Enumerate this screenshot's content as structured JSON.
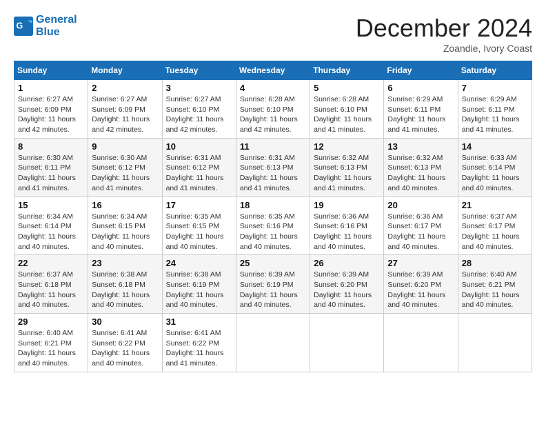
{
  "header": {
    "logo_line1": "General",
    "logo_line2": "Blue",
    "month_title": "December 2024",
    "location": "Zoandie, Ivory Coast"
  },
  "weekdays": [
    "Sunday",
    "Monday",
    "Tuesday",
    "Wednesday",
    "Thursday",
    "Friday",
    "Saturday"
  ],
  "weeks": [
    [
      {
        "day": "1",
        "sunrise": "6:27 AM",
        "sunset": "6:09 PM",
        "daylight": "11 hours and 42 minutes."
      },
      {
        "day": "2",
        "sunrise": "6:27 AM",
        "sunset": "6:09 PM",
        "daylight": "11 hours and 42 minutes."
      },
      {
        "day": "3",
        "sunrise": "6:27 AM",
        "sunset": "6:10 PM",
        "daylight": "11 hours and 42 minutes."
      },
      {
        "day": "4",
        "sunrise": "6:28 AM",
        "sunset": "6:10 PM",
        "daylight": "11 hours and 42 minutes."
      },
      {
        "day": "5",
        "sunrise": "6:28 AM",
        "sunset": "6:10 PM",
        "daylight": "11 hours and 41 minutes."
      },
      {
        "day": "6",
        "sunrise": "6:29 AM",
        "sunset": "6:11 PM",
        "daylight": "11 hours and 41 minutes."
      },
      {
        "day": "7",
        "sunrise": "6:29 AM",
        "sunset": "6:11 PM",
        "daylight": "11 hours and 41 minutes."
      }
    ],
    [
      {
        "day": "8",
        "sunrise": "6:30 AM",
        "sunset": "6:11 PM",
        "daylight": "11 hours and 41 minutes."
      },
      {
        "day": "9",
        "sunrise": "6:30 AM",
        "sunset": "6:12 PM",
        "daylight": "11 hours and 41 minutes."
      },
      {
        "day": "10",
        "sunrise": "6:31 AM",
        "sunset": "6:12 PM",
        "daylight": "11 hours and 41 minutes."
      },
      {
        "day": "11",
        "sunrise": "6:31 AM",
        "sunset": "6:13 PM",
        "daylight": "11 hours and 41 minutes."
      },
      {
        "day": "12",
        "sunrise": "6:32 AM",
        "sunset": "6:13 PM",
        "daylight": "11 hours and 41 minutes."
      },
      {
        "day": "13",
        "sunrise": "6:32 AM",
        "sunset": "6:13 PM",
        "daylight": "11 hours and 40 minutes."
      },
      {
        "day": "14",
        "sunrise": "6:33 AM",
        "sunset": "6:14 PM",
        "daylight": "11 hours and 40 minutes."
      }
    ],
    [
      {
        "day": "15",
        "sunrise": "6:34 AM",
        "sunset": "6:14 PM",
        "daylight": "11 hours and 40 minutes."
      },
      {
        "day": "16",
        "sunrise": "6:34 AM",
        "sunset": "6:15 PM",
        "daylight": "11 hours and 40 minutes."
      },
      {
        "day": "17",
        "sunrise": "6:35 AM",
        "sunset": "6:15 PM",
        "daylight": "11 hours and 40 minutes."
      },
      {
        "day": "18",
        "sunrise": "6:35 AM",
        "sunset": "6:16 PM",
        "daylight": "11 hours and 40 minutes."
      },
      {
        "day": "19",
        "sunrise": "6:36 AM",
        "sunset": "6:16 PM",
        "daylight": "11 hours and 40 minutes."
      },
      {
        "day": "20",
        "sunrise": "6:36 AM",
        "sunset": "6:17 PM",
        "daylight": "11 hours and 40 minutes."
      },
      {
        "day": "21",
        "sunrise": "6:37 AM",
        "sunset": "6:17 PM",
        "daylight": "11 hours and 40 minutes."
      }
    ],
    [
      {
        "day": "22",
        "sunrise": "6:37 AM",
        "sunset": "6:18 PM",
        "daylight": "11 hours and 40 minutes."
      },
      {
        "day": "23",
        "sunrise": "6:38 AM",
        "sunset": "6:18 PM",
        "daylight": "11 hours and 40 minutes."
      },
      {
        "day": "24",
        "sunrise": "6:38 AM",
        "sunset": "6:19 PM",
        "daylight": "11 hours and 40 minutes."
      },
      {
        "day": "25",
        "sunrise": "6:39 AM",
        "sunset": "6:19 PM",
        "daylight": "11 hours and 40 minutes."
      },
      {
        "day": "26",
        "sunrise": "6:39 AM",
        "sunset": "6:20 PM",
        "daylight": "11 hours and 40 minutes."
      },
      {
        "day": "27",
        "sunrise": "6:39 AM",
        "sunset": "6:20 PM",
        "daylight": "11 hours and 40 minutes."
      },
      {
        "day": "28",
        "sunrise": "6:40 AM",
        "sunset": "6:21 PM",
        "daylight": "11 hours and 40 minutes."
      }
    ],
    [
      {
        "day": "29",
        "sunrise": "6:40 AM",
        "sunset": "6:21 PM",
        "daylight": "11 hours and 40 minutes."
      },
      {
        "day": "30",
        "sunrise": "6:41 AM",
        "sunset": "6:22 PM",
        "daylight": "11 hours and 40 minutes."
      },
      {
        "day": "31",
        "sunrise": "6:41 AM",
        "sunset": "6:22 PM",
        "daylight": "11 hours and 41 minutes."
      },
      null,
      null,
      null,
      null
    ]
  ]
}
